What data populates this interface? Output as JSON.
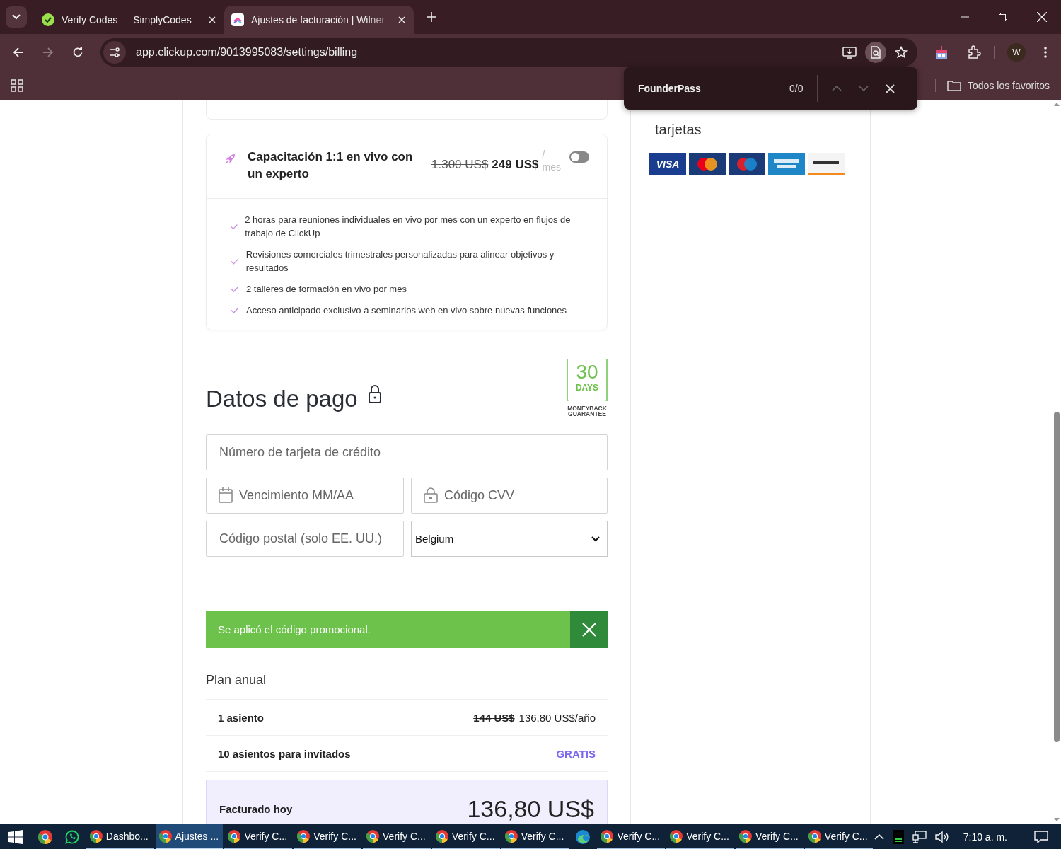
{
  "browser": {
    "tabs": [
      {
        "title": "Verify Codes — SimplyCodes",
        "selected": false
      },
      {
        "title": "Ajustes de facturación | Wilner",
        "selected": true
      }
    ],
    "url": "app.clickup.com/9013995083/settings/billing",
    "profile": "W",
    "bookmarks_folder": "Todos los favoritos",
    "find_bar": {
      "query": "FounderPass",
      "count": "0/0"
    }
  },
  "addon": {
    "title": "Capacitación 1:1 en vivo con un experto",
    "old_price": "1.300 US$",
    "price": "249 US$",
    "slash": "/",
    "period": "mes",
    "on": false,
    "features": [
      "2 horas para reuniones individuales en vivo por mes con un experto en flujos de trabajo de ClickUp",
      "Revisiones comerciales trimestrales personalizadas para alinear objetivos y resultados",
      "2 talleres de formación en vivo por mes",
      "Acceso anticipado exclusivo a seminarios web en vivo sobre nuevas funciones"
    ]
  },
  "payment": {
    "title": "Datos de pago",
    "badge": {
      "number": "30",
      "unit": "DAYS",
      "line1": "MONEYBACK",
      "line2": "GUARANTEE"
    },
    "card_number": {
      "placeholder": "Número de tarjeta de crédito"
    },
    "expiry": {
      "placeholder": "Vencimiento MM/AA"
    },
    "cvv": {
      "placeholder": "Código CVV"
    },
    "postal": {
      "placeholder": "Código postal (solo EE. UU.)"
    },
    "country": {
      "value": "Belgium"
    }
  },
  "promo": {
    "message": "Se aplicó el código promocional."
  },
  "plan": {
    "title": "Plan anual",
    "rows": [
      {
        "label": "1 asiento",
        "old_price": "144 US$",
        "price": "136,80 US$/año",
        "kind": "price"
      },
      {
        "label": "10 asientos para invitados",
        "price": "GRATIS",
        "kind": "free"
      }
    ],
    "total": {
      "label": "Facturado hoy",
      "amount": "136,80 US$"
    }
  },
  "cards_panel": {
    "title_line2": "tarjetas",
    "cards": [
      {
        "kind": "visa",
        "label": "VISA"
      },
      {
        "kind": "mastercard"
      },
      {
        "kind": "maestro"
      },
      {
        "kind": "amex"
      },
      {
        "kind": "discover"
      }
    ]
  },
  "taskbar": {
    "items": [
      {
        "kind": "chrome"
      },
      {
        "kind": "whatsapp"
      },
      {
        "kind": "window",
        "label": "Dashbo...",
        "selected": false
      },
      {
        "kind": "window",
        "label": "Ajustes ...",
        "selected": true
      },
      {
        "kind": "window",
        "label": "Verify C...",
        "selected": false
      },
      {
        "kind": "window",
        "label": "Verify C...",
        "selected": false
      },
      {
        "kind": "window",
        "label": "Verify C...",
        "selected": false
      },
      {
        "kind": "window",
        "label": "Verify C...",
        "selected": false
      },
      {
        "kind": "window",
        "label": "Verify C...",
        "selected": false
      },
      {
        "kind": "edge"
      },
      {
        "kind": "window",
        "label": "Verify C...",
        "selected": false
      },
      {
        "kind": "window",
        "label": "Verify C...",
        "selected": false
      },
      {
        "kind": "window",
        "label": "Verify C...",
        "selected": false
      },
      {
        "kind": "window",
        "label": "Verify C...",
        "selected": false
      }
    ],
    "clock": "7:10 a. m."
  }
}
